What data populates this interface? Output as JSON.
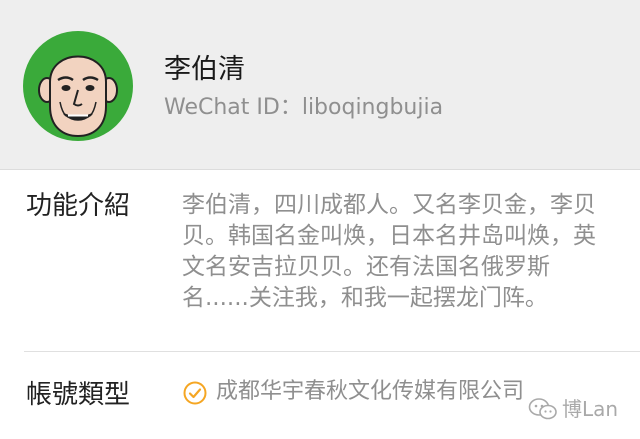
{
  "profile": {
    "name": "李伯清",
    "wechat_id": "WeChat ID：liboqingbujia",
    "avatar_icon": "cartoon-face-avatar",
    "avatar_bg_color": "#3aaa3a"
  },
  "intro": {
    "label": "功能介紹",
    "text": "李伯清，四川成都人。又名李贝金，李贝贝。韩国名金叫焕，日本名井岛叫焕，英文名安吉拉贝贝。还有法国名俄罗斯名......关注我，和我一起摆龙门阵。"
  },
  "account_type": {
    "label": "帳號類型",
    "value": "成都华宇春秋文化传媒有限公司",
    "icon": "verified-check-icon",
    "icon_color": "#f5a623"
  },
  "watermark": {
    "text": "博Lan",
    "icon": "wechat-logo-icon"
  }
}
